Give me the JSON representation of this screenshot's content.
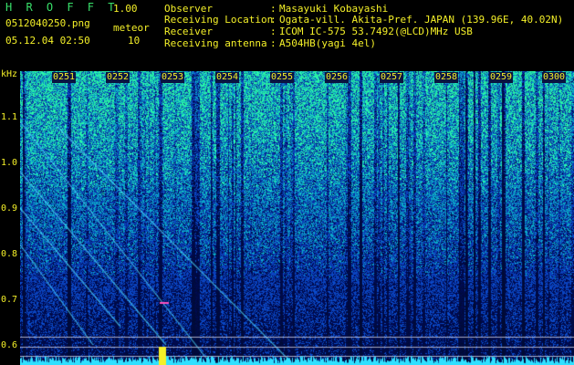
{
  "header": {
    "app_title": "H R O F F T",
    "app_version": "1.00",
    "file_name": "0512040250.png",
    "meteor_label": "meteor",
    "date_time": "05.12.04 02:50",
    "meteor_count": "10"
  },
  "info": [
    {
      "key": "Observer",
      "value": "Masayuki Kobayashi"
    },
    {
      "key": "Receiving Location",
      "value": "Ogata-vill. Akita-Pref. JAPAN (139.96E, 40.02N)"
    },
    {
      "key": "Receiver",
      "value": "ICOM IC-575 53.7492(@LCD)MHz USB"
    },
    {
      "key": "Receiving antenna",
      "value": "A504HB(yagi 4el)"
    }
  ],
  "colon": ":",
  "axis": {
    "unit": "kHz",
    "freq_ticks": [
      "1.1",
      "1.0",
      "0.9",
      "0.8",
      "0.7",
      "0.6"
    ],
    "time_ticks": [
      "0251",
      "0252",
      "0253",
      "0254",
      "0255",
      "0256",
      "0257",
      "0258",
      "0259",
      "0300"
    ]
  },
  "colors": {
    "background": "#000000",
    "noise_low": "#0a1a6a",
    "noise_high": "#1aa0d0",
    "signal": "#30e0ff",
    "meteor_burst": "#f4f028",
    "label": "#f4f028"
  },
  "icons": [
    "spectrogram-waterfall"
  ]
}
